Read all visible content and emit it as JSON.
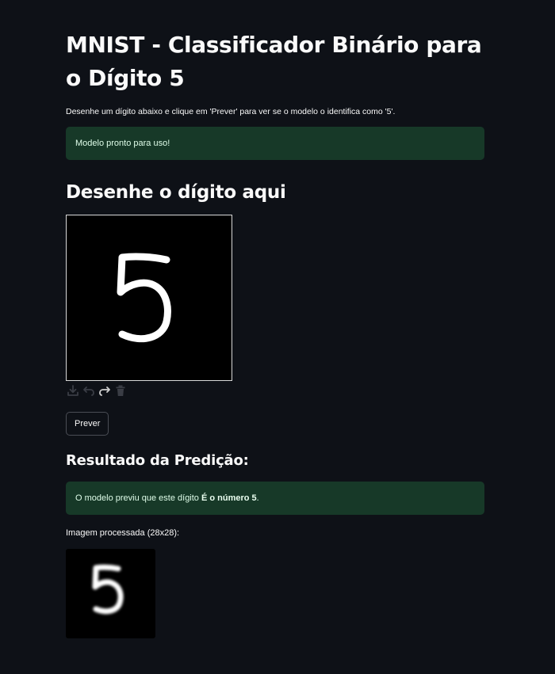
{
  "page": {
    "title": "MNIST - Classificador Binário para o Dígito 5",
    "description": "Desenhe um dígito abaixo e clique em 'Prever' para ver se o modelo o identifica como '5'.",
    "status_message": "Modelo pronto para uso!"
  },
  "canvas_section": {
    "heading": "Desenhe o dígito aqui",
    "canvas_background": "#000000",
    "stroke_color": "#ffffff",
    "toolbar": [
      {
        "icon": "download-icon"
      },
      {
        "icon": "undo-icon"
      },
      {
        "icon": "redo-icon"
      },
      {
        "icon": "trash-icon"
      }
    ]
  },
  "predict_button": {
    "label": "Prever"
  },
  "result": {
    "heading": "Resultado da Predição:",
    "message_prefix": "O modelo previu que este dígito ",
    "message_emphasis": "É o número 5",
    "message_suffix": ".",
    "processed_caption": "Imagem processada (28x28):"
  },
  "colors": {
    "background": "#0e1117",
    "success_bg": "#173928",
    "success_text": "#dffde9"
  }
}
